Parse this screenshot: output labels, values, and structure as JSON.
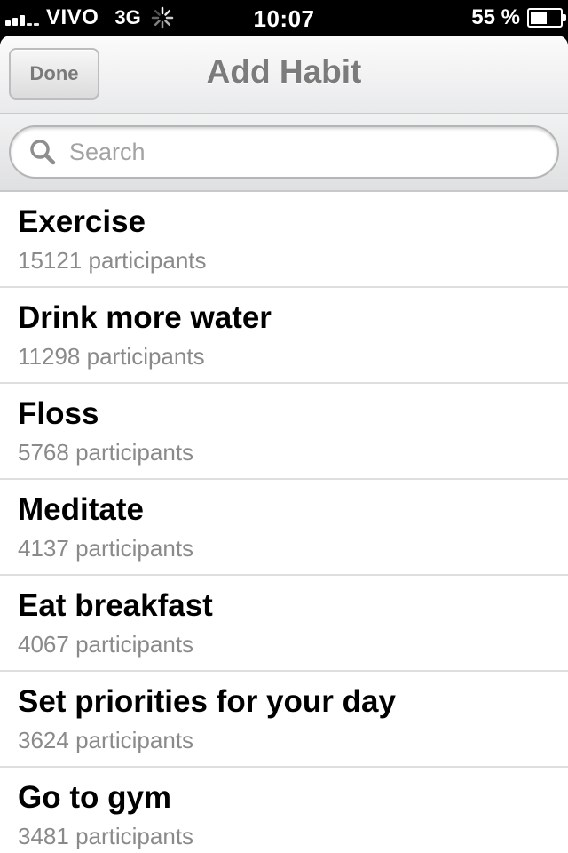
{
  "status_bar": {
    "carrier": "VIVO",
    "network": "3G",
    "time": "10:07",
    "battery_percent": "55 %",
    "battery_level": 0.55
  },
  "nav": {
    "done_label": "Done",
    "title": "Add Habit"
  },
  "search": {
    "placeholder": "Search",
    "value": ""
  },
  "habits": [
    {
      "title": "Exercise",
      "count": "15121",
      "unit": "participants"
    },
    {
      "title": "Drink more water",
      "count": "11298",
      "unit": "participants"
    },
    {
      "title": "Floss",
      "count": "5768",
      "unit": "participants"
    },
    {
      "title": "Meditate",
      "count": "4137",
      "unit": "participants"
    },
    {
      "title": "Eat breakfast",
      "count": "4067",
      "unit": "participants"
    },
    {
      "title": "Set priorities for your day",
      "count": "3624",
      "unit": "participants"
    },
    {
      "title": "Go to gym",
      "count": "3481",
      "unit": "participants"
    }
  ],
  "colors": {
    "title_text": "#7b7b7b",
    "subtitle_text": "#8a8a8a",
    "separator": "#dedede"
  }
}
